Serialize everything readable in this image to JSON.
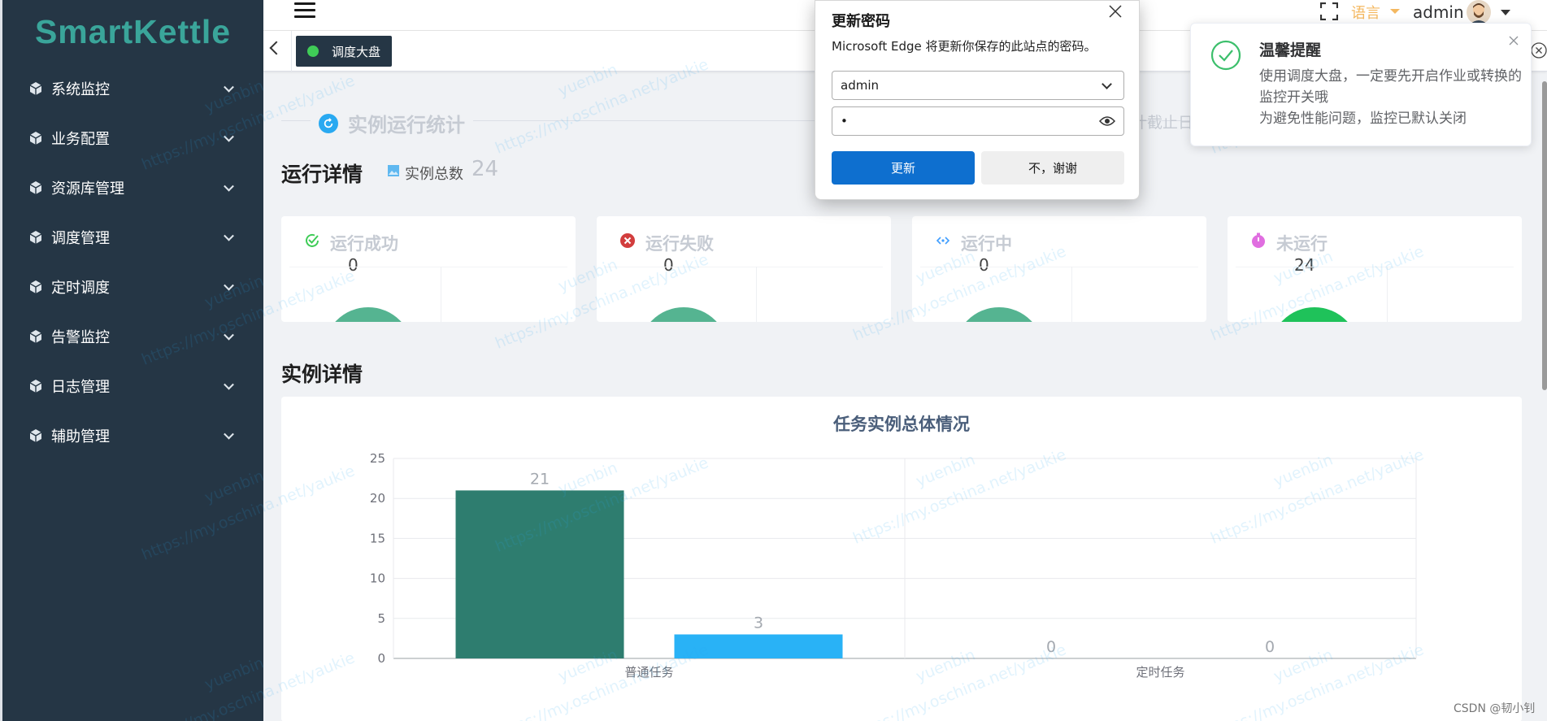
{
  "app": {
    "logo": "SmartKettle"
  },
  "sidebar": {
    "items": [
      {
        "label": "系统监控"
      },
      {
        "label": "业务配置"
      },
      {
        "label": "资源库管理"
      },
      {
        "label": "调度管理"
      },
      {
        "label": "定时调度"
      },
      {
        "label": "告警监控"
      },
      {
        "label": "日志管理"
      },
      {
        "label": "辅助管理"
      }
    ]
  },
  "header": {
    "language": "语言",
    "username": "admin"
  },
  "tags": {
    "active_label": "调度大盘"
  },
  "main": {
    "stat_title": "实例运行统计",
    "deadline_text": "计截止日",
    "run_title": "运行详情",
    "total_label": "实例总数",
    "total_value": "24",
    "cards": [
      {
        "label": "运行成功",
        "value": "0",
        "color": "#3fcc57"
      },
      {
        "label": "运行失败",
        "value": "0",
        "color": "#d23d3d"
      },
      {
        "label": "运行中",
        "value": "0",
        "color": "#409eff"
      },
      {
        "label": "未运行",
        "value": "24",
        "color": "#e06ee0"
      }
    ],
    "inst_title": "实例详情"
  },
  "chart_data": {
    "type": "bar",
    "title": "任务实例总体情况",
    "categories": [
      "普通任务",
      "定时任务"
    ],
    "series": [
      {
        "values": [
          21,
          0
        ],
        "color": "#2e7d6f"
      },
      {
        "values": [
          3,
          0
        ],
        "color": "#29b2f6"
      }
    ],
    "y_ticks": [
      0,
      5,
      10,
      15,
      20,
      25
    ],
    "ylim": [
      0,
      25
    ],
    "grid": true
  },
  "password_dialog": {
    "title": "更新密码",
    "description": "Microsoft Edge 将更新你保存的此站点的密码。",
    "username": "admin",
    "password_mask": "•",
    "update_label": "更新",
    "decline_label": "不，谢谢"
  },
  "notification": {
    "title": "温馨提醒",
    "line1": "使用调度大盘，一定要先开启作业或转换的监控开关哦",
    "line2": "为避免性能问题，监控已默认关闭"
  },
  "watermark": {
    "name": "yuenbin",
    "url": "https://my.oschina.net/yaukie"
  },
  "footer": {
    "credit": "CSDN @韧小钊"
  },
  "colors": {
    "sidebar_bg": "#253645",
    "brand": "#3aa59a",
    "primary": "#0e6fcf"
  }
}
